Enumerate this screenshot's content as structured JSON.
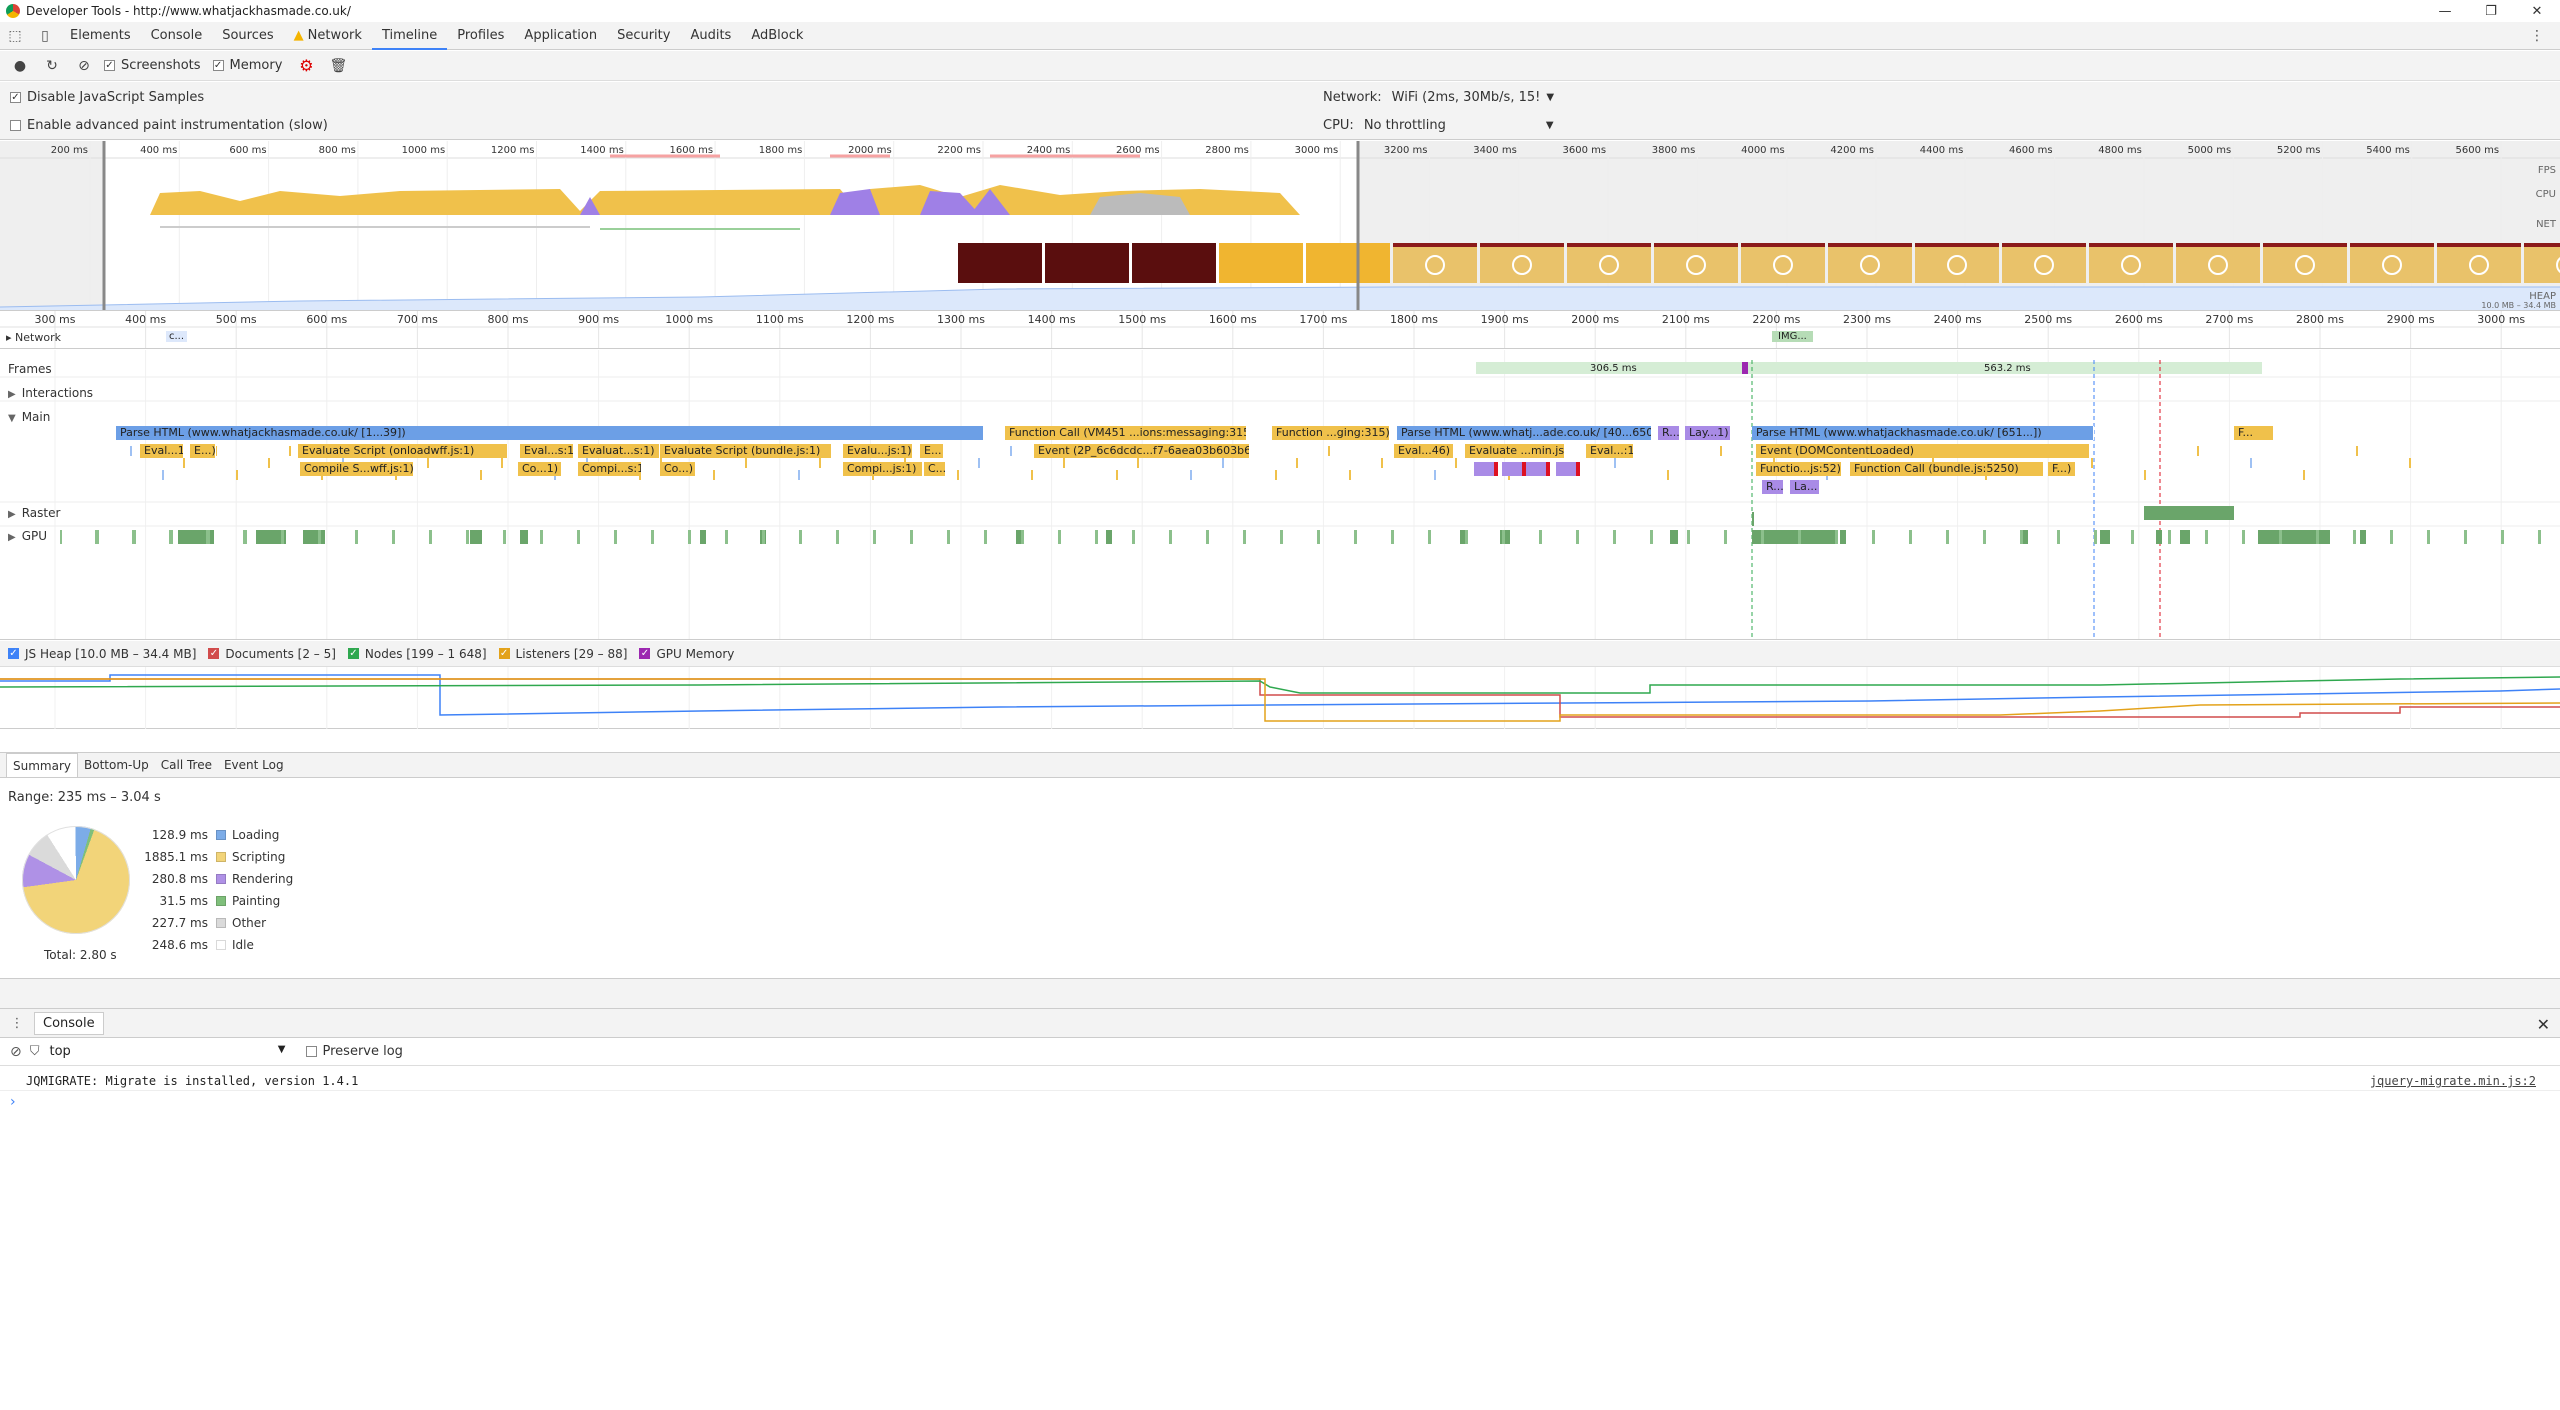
{
  "window": {
    "title": "Developer Tools - http://www.whatjackhasmade.co.uk/",
    "buttons": [
      "minimize",
      "maximize",
      "close"
    ]
  },
  "tabs": [
    {
      "label": "Elements"
    },
    {
      "label": "Console"
    },
    {
      "label": "Sources"
    },
    {
      "label": "Network",
      "warning": true
    },
    {
      "label": "Timeline",
      "active": true
    },
    {
      "label": "Profiles"
    },
    {
      "label": "Application"
    },
    {
      "label": "Security"
    },
    {
      "label": "Audits"
    },
    {
      "label": "AdBlock"
    }
  ],
  "toolbar": {
    "screenshots_label": "Screenshots",
    "screenshots_checked": true,
    "memory_label": "Memory",
    "memory_checked": true
  },
  "settings": {
    "disable_js_label": "Disable JavaScript Samples",
    "disable_js_checked": true,
    "paint_label": "Enable advanced paint instrumentation (slow)",
    "paint_checked": false,
    "network_label": "Network:",
    "network_value": "WiFi (2ms, 30Mb/s, 15!",
    "cpu_label": "CPU:",
    "cpu_value": "No throttling"
  },
  "overview": {
    "ticks": [
      "200 ms",
      "400 ms",
      "600 ms",
      "800 ms",
      "1000 ms",
      "1200 ms",
      "1400 ms",
      "1600 ms",
      "1800 ms",
      "2000 ms",
      "2200 ms",
      "2400 ms",
      "2600 ms",
      "2800 ms",
      "3000 ms",
      "3200 ms",
      "3400 ms",
      "3600 ms",
      "3800 ms",
      "4000 ms",
      "4200 ms",
      "4400 ms",
      "4600 ms",
      "4800 ms",
      "5000 ms",
      "5200 ms",
      "5400 ms",
      "5600 ms"
    ],
    "labels": [
      "FPS",
      "CPU",
      "NET",
      "HEAP"
    ],
    "heap_range": "10.0 MB – 34.4 MB"
  },
  "detail_ruler": {
    "ticks": [
      "300 ms",
      "400 ms",
      "500 ms",
      "600 ms",
      "700 ms",
      "800 ms",
      "900 ms",
      "1000 ms",
      "1100 ms",
      "1200 ms",
      "1300 ms",
      "1400 ms",
      "1500 ms",
      "1600 ms",
      "1700 ms",
      "1800 ms",
      "1900 ms",
      "2000 ms",
      "2100 ms",
      "2200 ms",
      "2300 ms",
      "2400 ms",
      "2500 ms",
      "2600 ms",
      "2700 ms",
      "2800 ms",
      "2900 ms",
      "3000 ms"
    ],
    "network_label": "Network",
    "network_items": [
      "c...",
      "c...",
      "IMG..."
    ]
  },
  "tracks": {
    "frames_label": "Frames",
    "frame_a": "306.5 ms",
    "frame_b": "563.2 ms",
    "interactions_label": "Interactions",
    "main_label": "Main",
    "raster_label": "Raster",
    "gpu_label": "GPU",
    "main_row1": [
      {
        "text": "Parse HTML (www.whatjackhasmade.co.uk/ [1...39])",
        "kind": "loading"
      },
      {
        "text": "Function Call (VM451 ...ions:messaging:315)",
        "kind": "scripting"
      },
      {
        "text": "Function ...ging:315)",
        "kind": "scripting"
      },
      {
        "text": "Parse HTML (www.whatj...ade.co.uk/ [40...650])",
        "kind": "loading"
      },
      {
        "text": "R...",
        "kind": "rendering"
      },
      {
        "text": "Lay...1)",
        "kind": "rendering"
      },
      {
        "text": "Parse HTML (www.whatjackhasmade.co.uk/ [651...])",
        "kind": "loading"
      },
      {
        "text": "F...",
        "kind": "scripting"
      }
    ],
    "main_row2": [
      {
        "text": "Eval...1)"
      },
      {
        "text": "E...)"
      },
      {
        "text": "Evaluate Script (onloadwff.js:1)"
      },
      {
        "text": "Eval...s:1)"
      },
      {
        "text": "Evaluat...s:1)"
      },
      {
        "text": "Evaluate Script (bundle.js:1)"
      },
      {
        "text": "Evalu...js:1)"
      },
      {
        "text": "E..."
      },
      {
        "text": "Event (2P_6c6dcdc...f7-6aea03b603b6)"
      },
      {
        "text": "Eval...46)"
      },
      {
        "text": "Evaluate ...min.js:1)"
      },
      {
        "text": "Eval...:1)"
      },
      {
        "text": "Event (DOMContentLoaded)"
      }
    ],
    "main_row3": [
      {
        "text": "Compile S...wff.js:1)"
      },
      {
        "text": "Co...1)"
      },
      {
        "text": "Compi...s:1)"
      },
      {
        "text": "Co...)"
      },
      {
        "text": "Compi...js:1)"
      },
      {
        "text": "C..."
      },
      {
        "text": "Functio...js:52)"
      },
      {
        "text": "Function Call (bundle.js:5250)"
      },
      {
        "text": "F...)"
      }
    ],
    "main_row4": [
      {
        "text": "R..."
      },
      {
        "text": "La..."
      }
    ]
  },
  "memory_legend": [
    {
      "label": "JS Heap [10.0 MB – 34.4 MB]",
      "color": "#3e82f7",
      "checked": true
    },
    {
      "label": "Documents [2 – 5]",
      "color": "#d14b4b",
      "checked": true
    },
    {
      "label": "Nodes [199 – 1 648]",
      "color": "#2fa84f",
      "checked": true
    },
    {
      "label": "Listeners [29 – 88]",
      "color": "#e3a21a",
      "checked": true
    },
    {
      "label": "GPU Memory",
      "color": "#9c27b0",
      "checked": true
    }
  ],
  "bottom_tabs": [
    {
      "label": "Summary",
      "active": true
    },
    {
      "label": "Bottom-Up"
    },
    {
      "label": "Call Tree"
    },
    {
      "label": "Event Log"
    }
  ],
  "summary": {
    "range": "Range: 235 ms – 3.04 s",
    "total": "Total: 2.80 s",
    "items": [
      {
        "value": "128.9 ms",
        "label": "Loading",
        "color": "#7cace8",
        "ms": 128.9
      },
      {
        "value": "1885.1 ms",
        "label": "Scripting",
        "color": "#f2d479",
        "ms": 1885.1
      },
      {
        "value": "280.8 ms",
        "label": "Rendering",
        "color": "#af91e6",
        "ms": 280.8
      },
      {
        "value": "31.5 ms",
        "label": "Painting",
        "color": "#7fbf7b",
        "ms": 31.5
      },
      {
        "value": "227.7 ms",
        "label": "Other",
        "color": "#dadada",
        "ms": 227.7
      },
      {
        "value": "248.6 ms",
        "label": "Idle",
        "color": "#ffffff",
        "ms": 248.6
      }
    ]
  },
  "console": {
    "tab_label": "Console",
    "context": "top",
    "preserve_label": "Preserve log",
    "message": "JQMIGRATE: Migrate is installed, version 1.4.1",
    "source": "jquery-migrate.min.js:2",
    "prompt": "›"
  }
}
